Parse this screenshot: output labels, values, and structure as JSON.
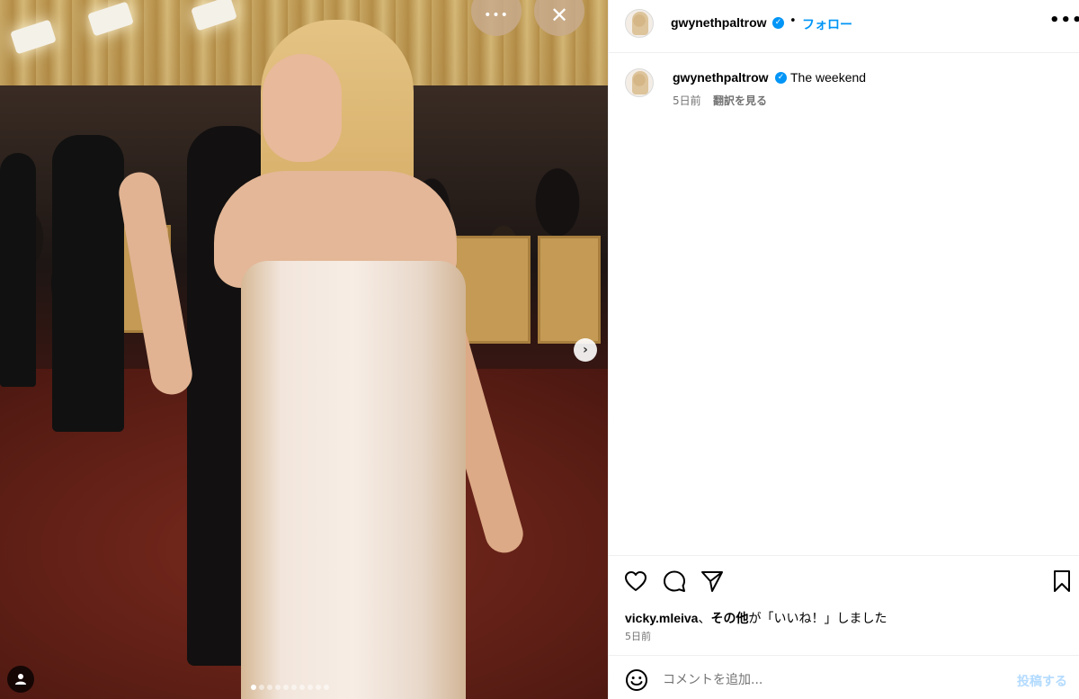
{
  "post": {
    "username": "gwynethpaltrow",
    "follow_label": "フォロー",
    "separator": "•",
    "options_label": "•••",
    "caption": "The weekend",
    "caption_time": "5日前",
    "see_translation": "翻訳を見る"
  },
  "media": {
    "more_label": "•••",
    "close_label": "✕",
    "next_label": "›",
    "slide_count": 10,
    "active_slide": 1
  },
  "engagement": {
    "liked_by_user": "vicky.mleiva",
    "liked_by_sep": "、",
    "liked_by_others": "その他",
    "liked_suffix": "が「いいね！」しました",
    "time": "5日前"
  },
  "comment": {
    "placeholder": "コメントを追加...",
    "post_label": "投稿する"
  },
  "icons": {
    "verified": "verified-badge-icon",
    "like": "heart-icon",
    "comment": "comment-bubble-icon",
    "share": "paper-plane-icon",
    "save": "bookmark-icon",
    "emoji": "emoji-icon",
    "user_tags": "person-icon"
  },
  "colors": {
    "accent": "#0095f6",
    "muted": "#737373",
    "post_disabled": "#b3dbff"
  }
}
